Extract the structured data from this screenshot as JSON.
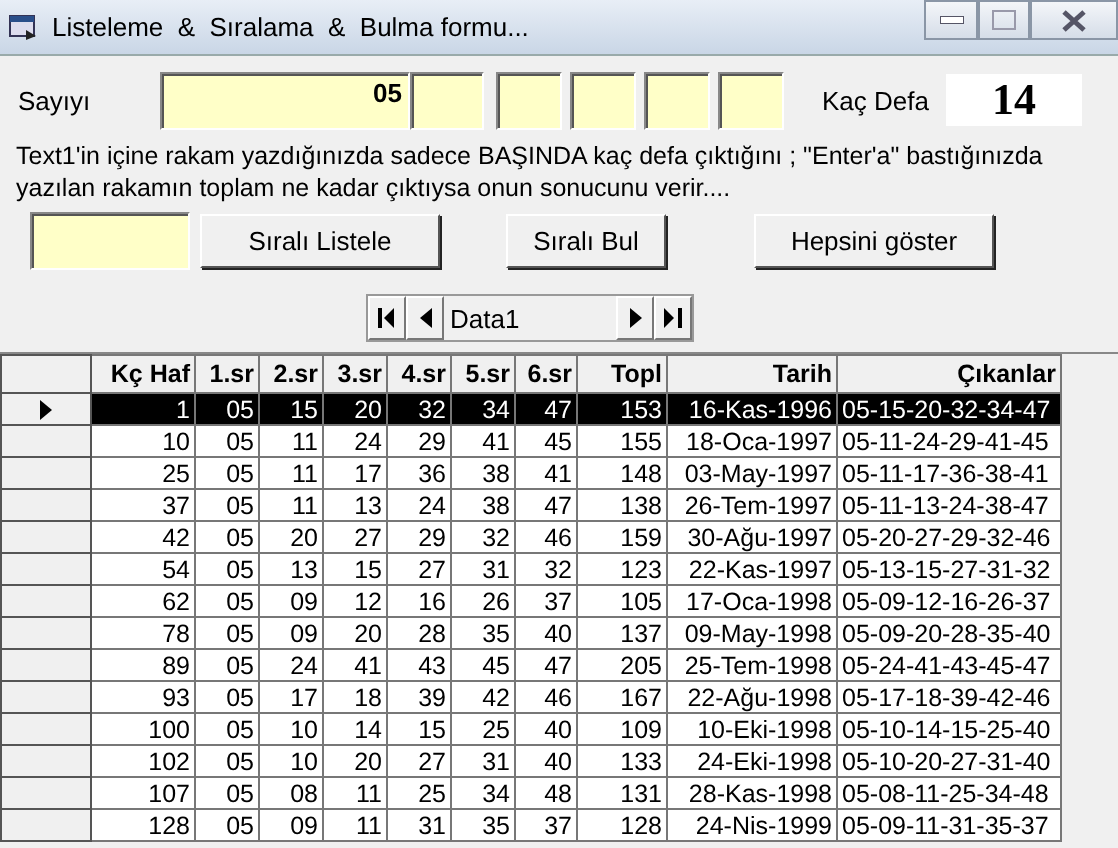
{
  "window": {
    "title": "Listeleme  &  Sıralama  &  Bulma formu..."
  },
  "number_label": "Sayıyı",
  "number_field": {
    "value": "05"
  },
  "count_label": "Kaç Defa",
  "count_value": "14",
  "help_text": [
    "Text1'in içine rakam yazdığınızda sadece BAŞINDA kaç defa çıktığını ; \"Enter'a\" bastığınızda",
    "yazılan rakamın  toplam  ne kadar çıktıysa onun sonucunu  verir...."
  ],
  "buttons": [
    {
      "label": "Sıralı  Listele"
    },
    {
      "label": "Sıralı Bul"
    },
    {
      "label": "Hepsini göster"
    }
  ],
  "navigator": {
    "caption": "Data1"
  },
  "table": {
    "columns": [
      "Kç Haf",
      "1.sr",
      "2.sr",
      "3.sr",
      "4.sr",
      "5.sr",
      "6.sr",
      "Topl",
      "Tarih",
      "Çıkanlar"
    ],
    "rows": [
      {
        "selected": true,
        "cells": [
          "1",
          "05",
          "15",
          "20",
          "32",
          "34",
          "47",
          "153",
          "16-Kas-1996",
          "05-15-20-32-34-47"
        ]
      },
      {
        "selected": false,
        "cells": [
          "10",
          "05",
          "11",
          "24",
          "29",
          "41",
          "45",
          "155",
          "18-Oca-1997",
          "05-11-24-29-41-45"
        ]
      },
      {
        "selected": false,
        "cells": [
          "25",
          "05",
          "11",
          "17",
          "36",
          "38",
          "41",
          "148",
          "03-May-1997",
          "05-11-17-36-38-41"
        ]
      },
      {
        "selected": false,
        "cells": [
          "37",
          "05",
          "11",
          "13",
          "24",
          "38",
          "47",
          "138",
          "26-Tem-1997",
          "05-11-13-24-38-47"
        ]
      },
      {
        "selected": false,
        "cells": [
          "42",
          "05",
          "20",
          "27",
          "29",
          "32",
          "46",
          "159",
          "30-Ağu-1997",
          "05-20-27-29-32-46"
        ]
      },
      {
        "selected": false,
        "cells": [
          "54",
          "05",
          "13",
          "15",
          "27",
          "31",
          "32",
          "123",
          "22-Kas-1997",
          "05-13-15-27-31-32"
        ]
      },
      {
        "selected": false,
        "cells": [
          "62",
          "05",
          "09",
          "12",
          "16",
          "26",
          "37",
          "105",
          "17-Oca-1998",
          "05-09-12-16-26-37"
        ]
      },
      {
        "selected": false,
        "cells": [
          "78",
          "05",
          "09",
          "20",
          "28",
          "35",
          "40",
          "137",
          "09-May-1998",
          "05-09-20-28-35-40"
        ]
      },
      {
        "selected": false,
        "cells": [
          "89",
          "05",
          "24",
          "41",
          "43",
          "45",
          "47",
          "205",
          "25-Tem-1998",
          "05-24-41-43-45-47"
        ]
      },
      {
        "selected": false,
        "cells": [
          "93",
          "05",
          "17",
          "18",
          "39",
          "42",
          "46",
          "167",
          "22-Ağu-1998",
          "05-17-18-39-42-46"
        ]
      },
      {
        "selected": false,
        "cells": [
          "100",
          "05",
          "10",
          "14",
          "15",
          "25",
          "40",
          "109",
          "10-Eki-1998",
          "05-10-14-15-25-40"
        ]
      },
      {
        "selected": false,
        "cells": [
          "102",
          "05",
          "10",
          "20",
          "27",
          "31",
          "40",
          "133",
          "24-Eki-1998",
          "05-10-20-27-31-40"
        ]
      },
      {
        "selected": false,
        "cells": [
          "107",
          "05",
          "08",
          "11",
          "25",
          "34",
          "48",
          "131",
          "28-Kas-1998",
          "05-08-11-25-34-48"
        ]
      },
      {
        "selected": false,
        "cells": [
          "128",
          "05",
          "09",
          "11",
          "31",
          "35",
          "37",
          "128",
          "24-Nis-1999",
          "05-09-11-31-35-37"
        ]
      }
    ]
  }
}
